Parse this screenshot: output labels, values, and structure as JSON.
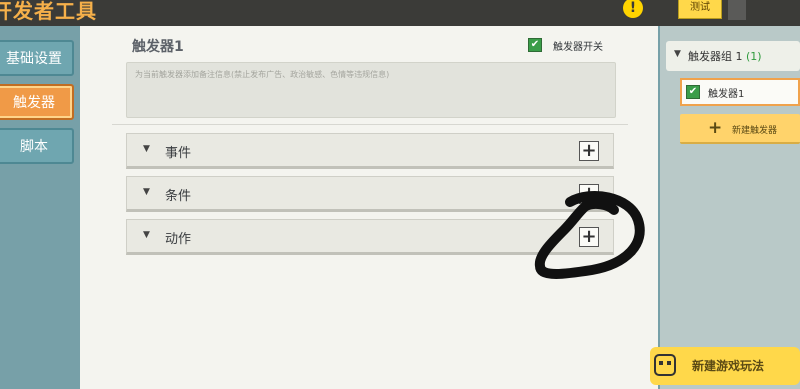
{
  "topbar": {
    "title": "开发者工具",
    "warning_icon": "exclamation-icon",
    "test_label": "测试"
  },
  "nav": {
    "items": [
      {
        "label": "基础设置"
      },
      {
        "label": "触发器",
        "selected": true
      },
      {
        "label": "脚本"
      }
    ]
  },
  "main": {
    "trigger_name": "触发器1",
    "switch_label": "触发器开关",
    "switch_checked": true,
    "note_placeholder": "为当前触发器添加备注信息(禁止发布广告、政治敏感、色情等违规信息)",
    "sections": [
      {
        "label": "事件",
        "expand_icon": "caret-down-icon",
        "add_icon": "plus-icon"
      },
      {
        "label": "条件",
        "expand_icon": "caret-down-icon",
        "add_icon": "plus-icon"
      },
      {
        "label": "动作",
        "expand_icon": "caret-down-icon",
        "add_icon": "plus-icon"
      }
    ]
  },
  "right": {
    "group_name": "触发器组 1",
    "group_count": "(1)",
    "items": [
      {
        "label": "触发器1",
        "checked": true
      }
    ],
    "new_button_label": "新建触发器"
  },
  "float_button": {
    "label": "新建游戏玩法"
  },
  "colors": {
    "accent_orange": "#f09a47",
    "accent_yellow": "#ffd84a",
    "check_green": "#3a9d49"
  }
}
